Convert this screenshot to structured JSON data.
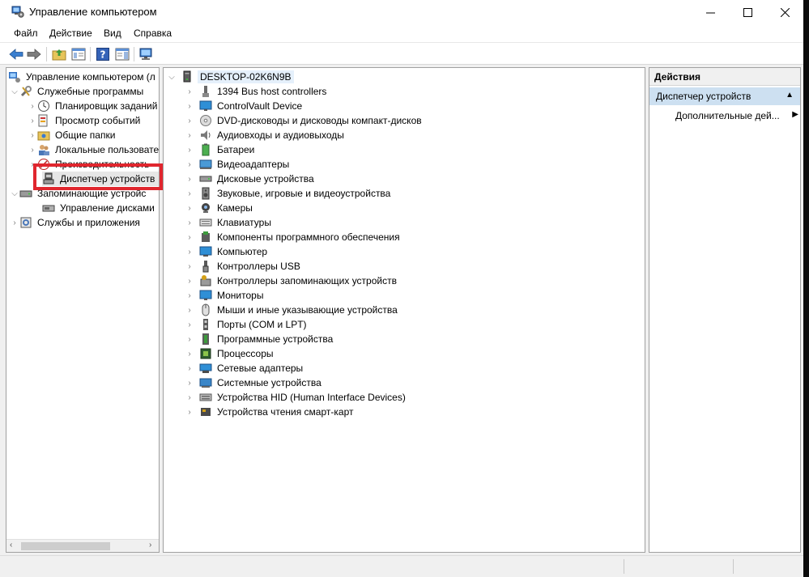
{
  "window": {
    "title": "Управление компьютером",
    "minimize_label": "–",
    "close_label": "✕"
  },
  "menu": [
    "Файл",
    "Действие",
    "Вид",
    "Справка"
  ],
  "left_tree": {
    "root": "Управление компьютером (л",
    "system_tools": "Служебные программы",
    "task_scheduler": "Планировщик заданий",
    "event_viewer": "Просмотр событий",
    "shared_folders": "Общие папки",
    "local_users": "Локальные пользовате",
    "performance": "Производительность",
    "device_manager": "Диспетчер устройств",
    "storage": "Запоминающие устройс",
    "disk_management": "Управление дисками",
    "services": "Службы и приложения"
  },
  "device_tree": {
    "computer": "DESKTOP-02K6N9B",
    "categories": [
      {
        "label": "1394 Bus host controllers",
        "icon": "bus-icon"
      },
      {
        "label": "ControlVault Device",
        "icon": "monitor-icon"
      },
      {
        "label": "DVD-дисководы и дисководы компакт-дисков",
        "icon": "dvd-icon"
      },
      {
        "label": "Аудиовходы и аудиовыходы",
        "icon": "audio-icon"
      },
      {
        "label": "Батареи",
        "icon": "battery-icon"
      },
      {
        "label": "Видеоадаптеры",
        "icon": "display-adapter-icon"
      },
      {
        "label": "Дисковые устройства",
        "icon": "disk-icon"
      },
      {
        "label": "Звуковые, игровые и видеоустройства",
        "icon": "speaker-icon"
      },
      {
        "label": "Камеры",
        "icon": "camera-icon"
      },
      {
        "label": "Клавиатуры",
        "icon": "keyboard-icon"
      },
      {
        "label": "Компоненты программного обеспечения",
        "icon": "software-component-icon"
      },
      {
        "label": "Компьютер",
        "icon": "computer-icon"
      },
      {
        "label": "Контроллеры USB",
        "icon": "usb-icon"
      },
      {
        "label": "Контроллеры запоминающих устройств",
        "icon": "storage-controller-icon"
      },
      {
        "label": "Мониторы",
        "icon": "monitor-icon"
      },
      {
        "label": "Мыши и иные указывающие устройства",
        "icon": "mouse-icon"
      },
      {
        "label": "Порты (COM и LPT)",
        "icon": "port-icon"
      },
      {
        "label": "Программные устройства",
        "icon": "software-device-icon"
      },
      {
        "label": "Процессоры",
        "icon": "cpu-icon"
      },
      {
        "label": "Сетевые адаптеры",
        "icon": "network-icon"
      },
      {
        "label": "Системные устройства",
        "icon": "system-icon"
      },
      {
        "label": "Устройства HID (Human Interface Devices)",
        "icon": "hid-icon"
      },
      {
        "label": "Устройства чтения смарт-карт",
        "icon": "smartcard-icon"
      }
    ]
  },
  "actions": {
    "header": "Действия",
    "section": "Диспетчер устройств",
    "more": "Дополнительные дей..."
  },
  "colors": {
    "highlight": "#e0262e",
    "selection": "#cde0f1"
  }
}
